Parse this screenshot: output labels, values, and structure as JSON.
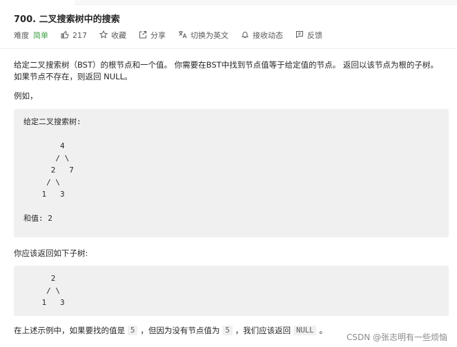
{
  "problem": {
    "title": "700. 二叉搜索树中的搜索",
    "difficulty_label": "难度",
    "difficulty": "简单",
    "likes": "217",
    "favorite": "收藏",
    "share": "分享",
    "switch_lang": "切换为英文",
    "notify": "接收动态",
    "feedback": "反馈"
  },
  "description": {
    "line1": "给定二叉搜索树（BST）的根节点和一个值。 你需要在BST中找到节点值等于给定值的节点。 返回以该节点为根的子树。",
    "line2": "如果节点不存在，则返回 NULL。",
    "example_intro": "例如，",
    "example_block": "给定二叉搜索树:\n\n        4\n       / \\\n      2   7\n     / \\\n    1   3\n\n和值: 2",
    "should_return": "你应该返回如下子树:",
    "result_block": "      2\n     / \\\n    1   3",
    "final_pre": "在上述示例中，如果要找的值是",
    "final_val": "5",
    "final_mid": "，但因为没有节点值为",
    "final_val2": "5",
    "final_post": "，我们应该返回",
    "final_null": "NULL",
    "final_end": "。"
  },
  "watermark": "CSDN @张志明有一些烦恼",
  "colors": {
    "easy": "#43a047",
    "codebg": "#f0f0f0"
  }
}
